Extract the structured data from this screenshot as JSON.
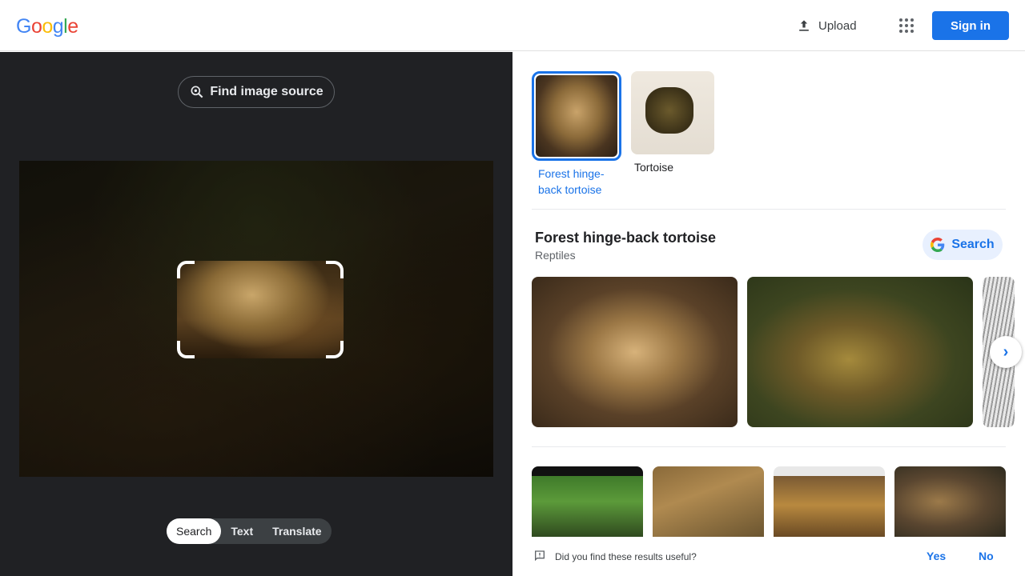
{
  "header": {
    "logo_letters": [
      "G",
      "o",
      "o",
      "g",
      "l",
      "e"
    ],
    "logo_colors": [
      "#4285F4",
      "#EA4335",
      "#FBBC05",
      "#4285F4",
      "#34A853",
      "#EA4335"
    ],
    "upload_label": "Upload",
    "apps_icon": "apps-grid-icon",
    "signin_label": "Sign in"
  },
  "left_panel": {
    "find_source_label": "Find image source",
    "modes": [
      "Search",
      "Text",
      "Translate"
    ],
    "active_mode": "Search"
  },
  "right_panel": {
    "chips": [
      {
        "label": "Forest hinge-back tortoise",
        "active": true
      },
      {
        "label": "Tortoise",
        "active": false
      }
    ],
    "entity": {
      "title": "Forest hinge-back tortoise",
      "subtitle": "Reptiles",
      "search_label": "Search"
    },
    "feedback": {
      "question": "Did you find these results useful?",
      "yes": "Yes",
      "no": "No"
    }
  },
  "colors": {
    "accent": "#1a73e8",
    "dark_panel": "#202124"
  }
}
